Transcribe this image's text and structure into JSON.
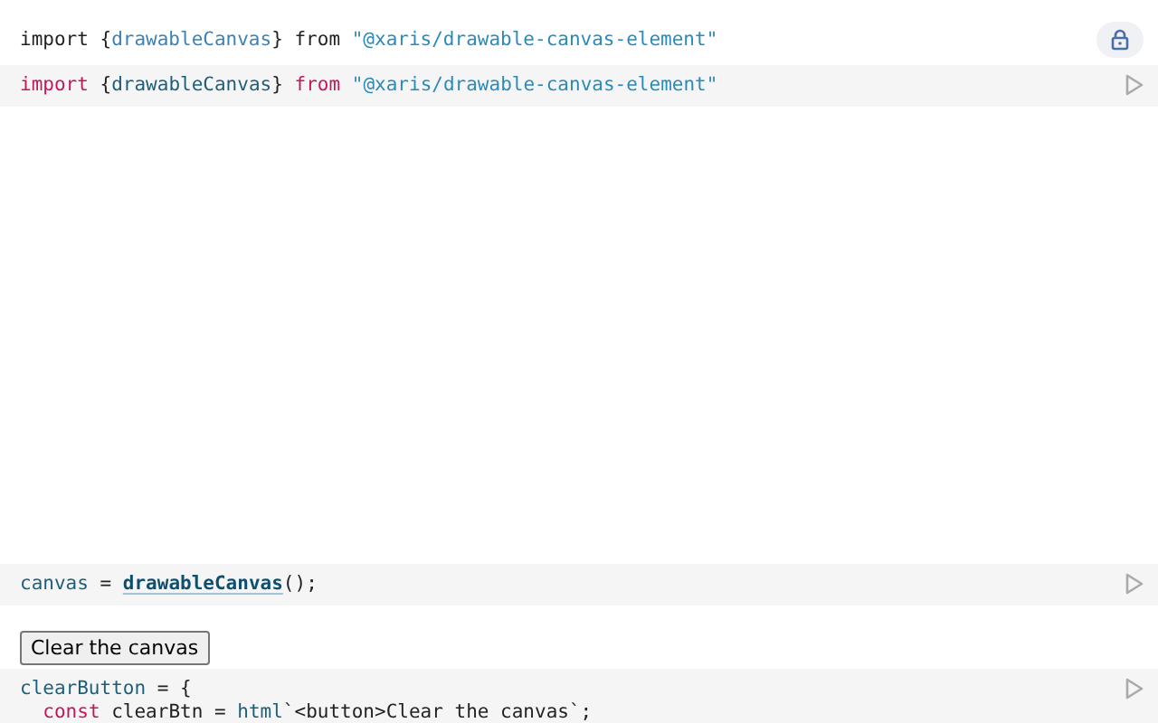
{
  "cells": [
    {
      "kind": "output",
      "lock": true,
      "lines": [
        [
          {
            "kind": "plain",
            "text": "import {"
          },
          {
            "kind": "name",
            "text": "drawableCanvas"
          },
          {
            "kind": "plain",
            "text": "} from "
          },
          {
            "kind": "string",
            "text": "\"@xaris/drawable-canvas-element\""
          }
        ]
      ]
    },
    {
      "kind": "code",
      "lines": [
        [
          {
            "kind": "keyword",
            "text": "import"
          },
          {
            "kind": "plain",
            "text": " {"
          },
          {
            "kind": "var",
            "text": "drawableCanvas"
          },
          {
            "kind": "plain",
            "text": "} "
          },
          {
            "kind": "keyword",
            "text": "from"
          },
          {
            "kind": "string",
            "text": "\"@xaris/drawable-canvas-element\""
          }
        ]
      ]
    },
    {
      "kind": "canvas"
    },
    {
      "kind": "code",
      "lines": [
        [
          {
            "kind": "var",
            "text": "canvas"
          },
          {
            "kind": "plain",
            "text": " = "
          },
          {
            "kind": "call",
            "text": "drawableCanvas"
          },
          {
            "kind": "plain",
            "text": "();"
          }
        ]
      ]
    },
    {
      "kind": "button",
      "label": "Clear the canvas"
    },
    {
      "kind": "code",
      "lines": [
        [
          {
            "kind": "var",
            "text": "clearButton"
          },
          {
            "kind": "plain",
            "text": " = {"
          }
        ],
        [
          {
            "kind": "keyword",
            "text": "const"
          },
          {
            "kind": "plain",
            "text": " clearBtn = "
          },
          {
            "kind": "var",
            "text": "html"
          },
          {
            "kind": "plain",
            "text": "`<button>Clear the canvas`;"
          }
        ]
      ]
    }
  ]
}
